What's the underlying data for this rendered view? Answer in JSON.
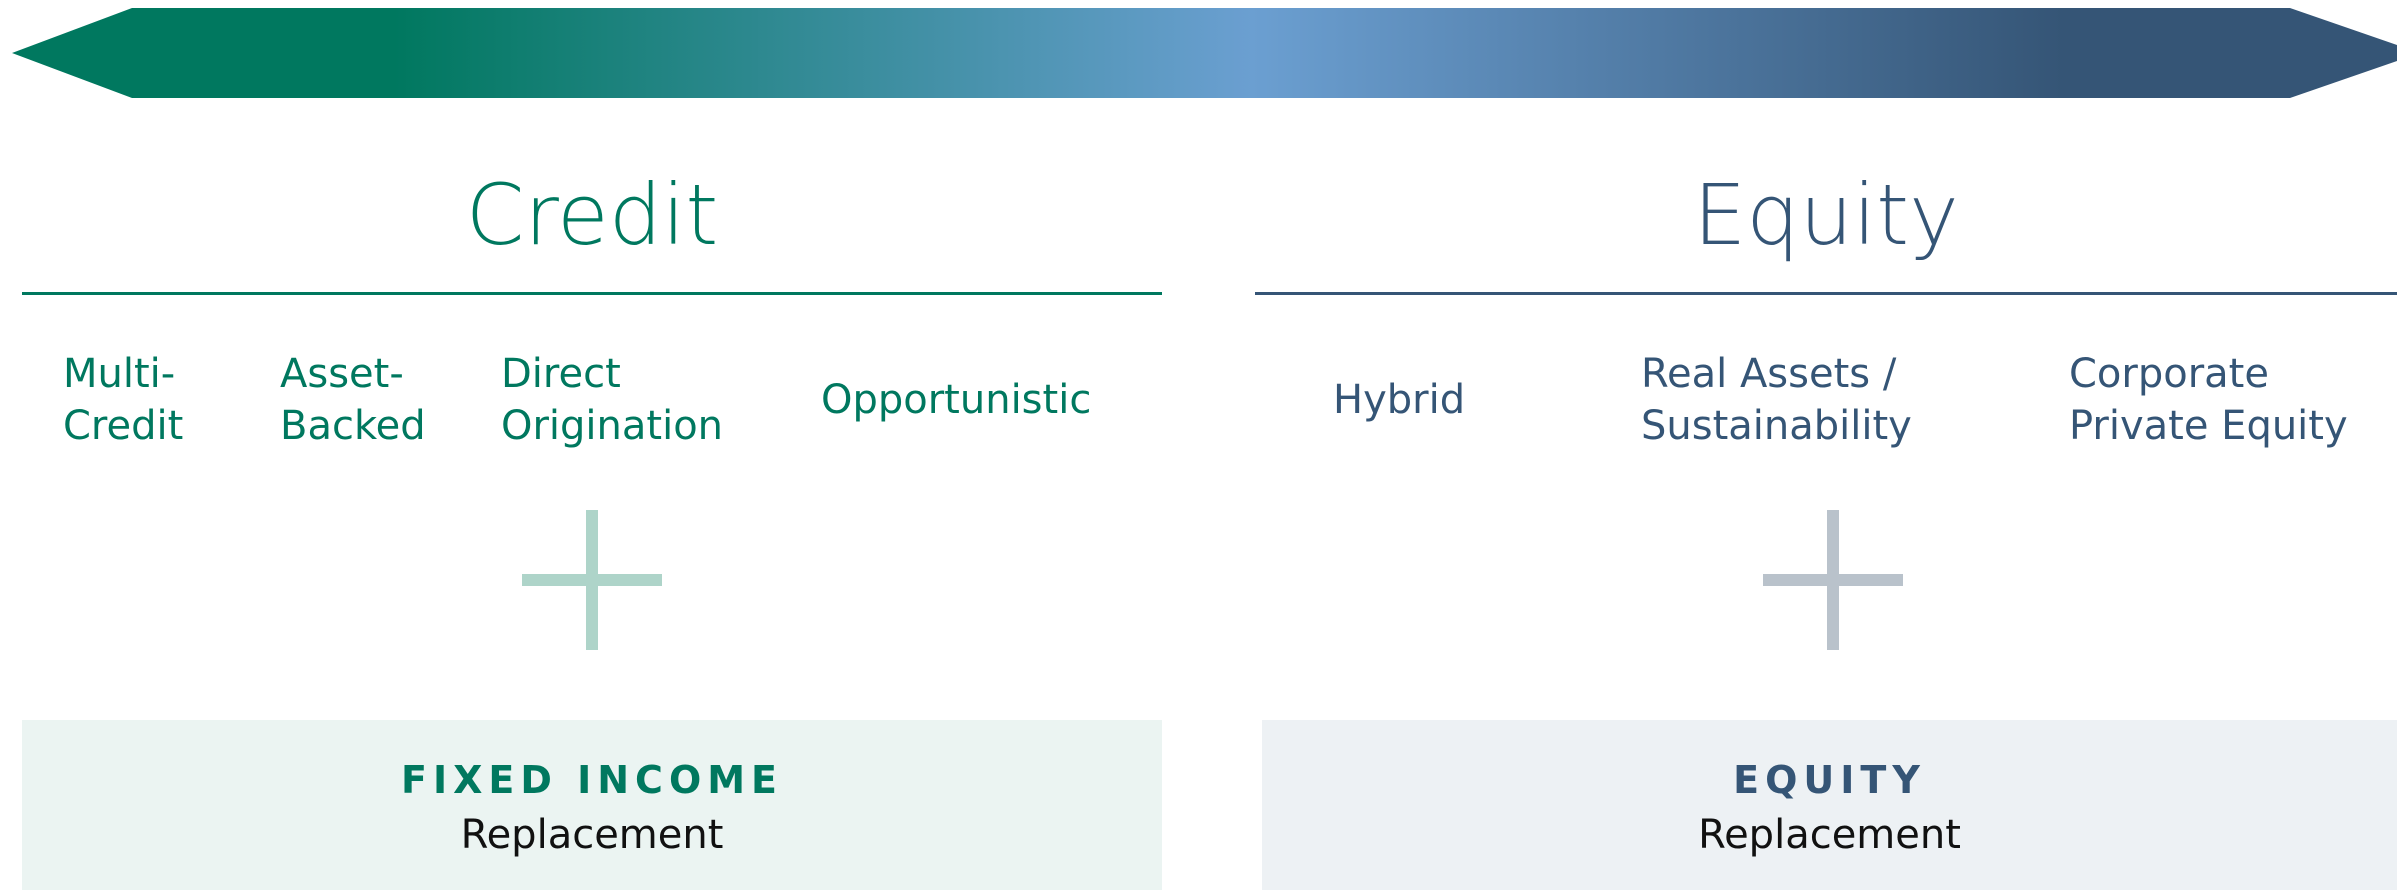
{
  "colors": {
    "credit_accent": "#00785f",
    "equity_accent": "#355576",
    "gradient_mid": "#6b9fd1",
    "credit_plus": "#aed4c9",
    "equity_plus": "#b9c2cb",
    "credit_box_bg": "#ebf4f2",
    "equity_box_bg": "#edf1f4"
  },
  "credit": {
    "title": "Credit",
    "categories": [
      "Multi-\nCredit",
      "Asset-\nBacked",
      "Direct\nOrigination",
      "Opportunistic"
    ],
    "box_heading": "FIXED INCOME",
    "box_subheading": "Replacement"
  },
  "equity": {
    "title": "Equity",
    "categories": [
      "Hybrid",
      "Real Assets /\nSustainability",
      "Corporate\nPrivate Equity"
    ],
    "box_heading": "EQUITY",
    "box_subheading": "Replacement"
  },
  "icons": {
    "arrow": "double-headed-arrow-icon",
    "plus": "plus-icon"
  }
}
